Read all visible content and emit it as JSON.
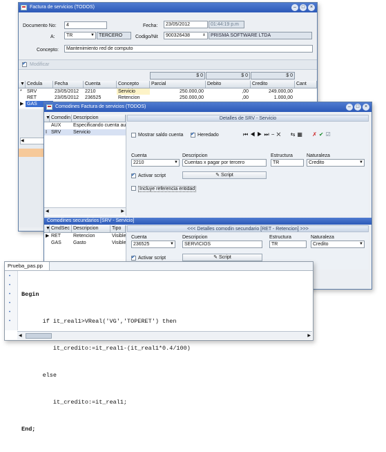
{
  "main_window": {
    "title": "Factura de servicios (TODOS)",
    "documento_label": "Documento No:",
    "documento_value": "4",
    "fecha_label": "Fecha:",
    "fecha_value": "23/05/2012",
    "hora_value": "01:44:19 p.m",
    "a_label": "A:",
    "a_code": "TR",
    "a_name": "TERCERO",
    "codigo_label": "Codigo/Nit",
    "codigo_value": "900326438",
    "codigo_name": "PRISMA SOFTWARE LTDA",
    "concepto_label": "Concepto:",
    "concepto_value": "Mantenimiento red de computo",
    "modificar_label": "Modificar",
    "totals": [
      "$ 0",
      "$ 0",
      "$ 0"
    ],
    "columns": [
      "Cedula",
      "Fecha",
      "Cuenta",
      "Concepto",
      "Parcial",
      "Debito",
      "Credito",
      "Cant"
    ],
    "rows": [
      {
        "cedula": "SRV",
        "fecha": "23/05/2012",
        "cuenta": "2210",
        "concepto": "Servicio",
        "parcial": "250.000,00",
        "debito": ",00",
        "credito": "249.000,00"
      },
      {
        "cedula": "RET",
        "fecha": "23/05/2012",
        "cuenta": "236525",
        "concepto": "Retencion",
        "parcial": "250.000,00",
        "debito": ",00",
        "credito": "1.000,00"
      },
      {
        "cedula": "GAS",
        "fecha": "",
        "cuenta": "",
        "concepto": "",
        "parcial": "",
        "debito": "",
        "credito": ""
      }
    ]
  },
  "comodines_window": {
    "title": "Comodines Factura de servicios (TODOS)",
    "list_columns": [
      "Comodin",
      "Descripcion"
    ],
    "list_rows": [
      {
        "code": "AUX",
        "desc": "Especificando cuenta au..."
      },
      {
        "code": "SRV",
        "desc": "Servicio"
      }
    ],
    "detalles_title": "Detalles de SRV - Servicio",
    "mostrar_saldo_label": "Mostrar saldo cuenta",
    "heredado_label": "Heredado",
    "cuenta_label": "Cuenta",
    "cuenta_value": "2210",
    "descripcion_label": "Descripcion",
    "descripcion_value": "Cuentas x pagar por tercero",
    "estructura_label": "Estructura",
    "estructura_value": "TR",
    "naturaleza_label": "Naturaleza",
    "naturaleza_value": "Credito",
    "activar_script_label": "Activar script",
    "script_button_label": "Script",
    "incluye_referencia_label": "Incluye referencia entidad",
    "secundarios_title": "Comodines secundarios [SRV - Servicio]",
    "sec_columns": [
      "CmdSec",
      "Descripcion",
      "Tipo"
    ],
    "sec_rows": [
      {
        "code": "RET",
        "desc": "Retencion",
        "tipo": "Visible"
      },
      {
        "code": "GAS",
        "desc": "Gasto",
        "tipo": "Visible"
      }
    ],
    "sec_detalles_title": "<<< Detalles comodin secundario [RET - Retencion] >>>",
    "sec_cuenta_label": "Cuenta",
    "sec_cuenta_value": "236525",
    "sec_descripcion_label": "Descripcion",
    "sec_descripcion_value": "SERVICIOS",
    "sec_estructura_label": "Estructura",
    "sec_estructura_value": "TR",
    "sec_naturaleza_label": "Naturaleza",
    "sec_naturaleza_value": "Credito",
    "sec_activar_script_label": "Activar script",
    "sec_script_button_label": "Script"
  },
  "script_editor": {
    "tab": "Prueba_pas.pp",
    "lines": [
      "Begin",
      "      if it_real1>VReal('VG','TOPERET') then",
      "         it_credito:=it_real1-(it_real1*0.4/100)",
      "      else",
      "         it_credito:=it_real1;",
      "End;"
    ]
  }
}
